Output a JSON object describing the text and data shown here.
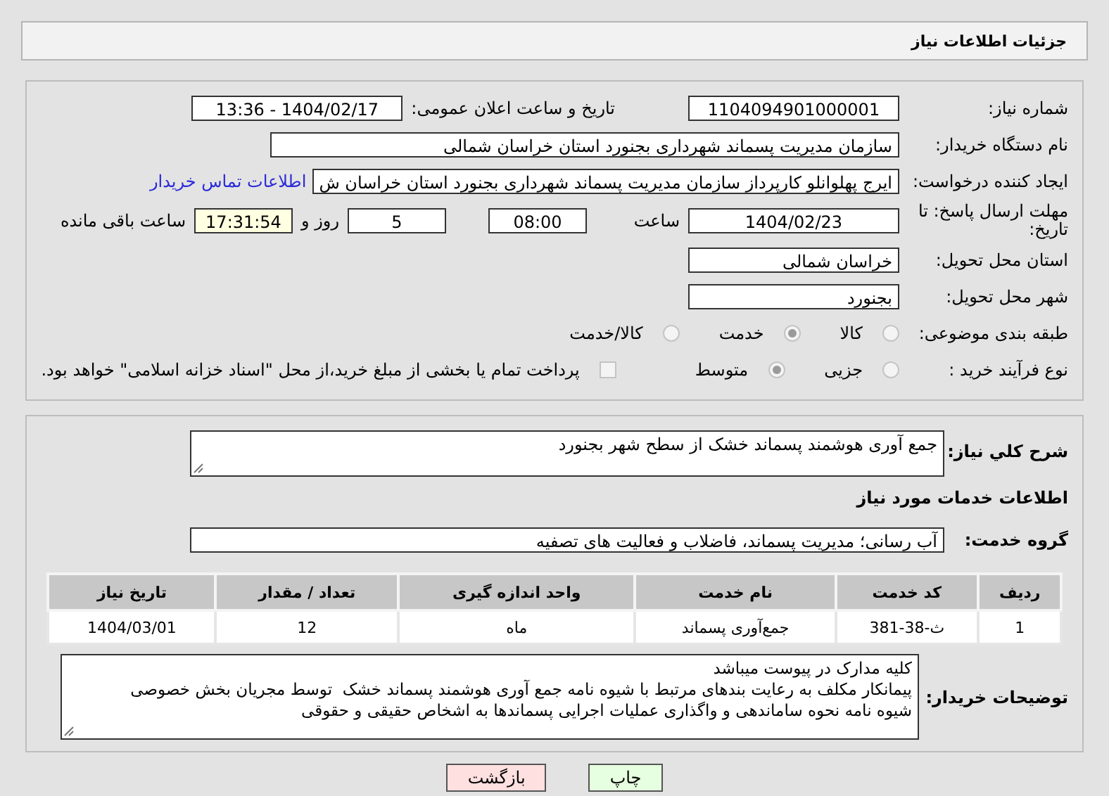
{
  "header": {
    "title": "جزئیات اطلاعات نیاز"
  },
  "need_number": {
    "label": "شماره نیاز:",
    "value": "1104094901000001"
  },
  "announce": {
    "label": "تاریخ و ساعت اعلان عمومی:",
    "value": "1404/02/17 - 13:36"
  },
  "buyer_org": {
    "label": "نام دستگاه خریدار:",
    "value": "سازمان مدیریت پسماند شهرداری بجنورد استان خراسان شمالی"
  },
  "requester": {
    "label": "ایجاد کننده درخواست:",
    "value": "ایرج پهلوانلو کارپرداز سازمان مدیریت پسماند شهرداری بجنورد استان خراسان ش",
    "link": "اطلاعات تماس خریدار"
  },
  "deadline": {
    "label": "مهلت ارسال پاسخ: تا تاریخ:",
    "date": "1404/02/23",
    "time_label": "ساعت",
    "time": "08:00",
    "days": "5",
    "days_label": "روز و",
    "remaining": "17:31:54",
    "remaining_label": "ساعت باقی مانده"
  },
  "province": {
    "label": "استان محل تحویل:",
    "value": "خراسان شمالی"
  },
  "city": {
    "label": "شهر محل تحویل:",
    "value": "بجنورد"
  },
  "category": {
    "label": "طبقه بندی موضوعی:",
    "options": [
      {
        "label": "کالا",
        "selected": false
      },
      {
        "label": "خدمت",
        "selected": true
      },
      {
        "label": "کالا/خدمت",
        "selected": false
      }
    ]
  },
  "process": {
    "label": "نوع فرآیند خرید :",
    "options": [
      {
        "label": "جزیی",
        "selected": false
      },
      {
        "label": "متوسط",
        "selected": true
      }
    ],
    "payment": {
      "label": "پرداخت تمام یا بخشی از مبلغ خرید،از محل \"اسناد خزانه اسلامی\" خواهد بود.",
      "checked": false
    }
  },
  "summary": {
    "label": "شرح کلي نياز:",
    "value": "جمع آوری هوشمند پسماند خشک از سطح شهر بجنورد"
  },
  "services_title": "اطلاعات خدمات مورد نیاز",
  "service_group": {
    "label": "گروه خدمت:",
    "value": "آب رسانی؛ مدیریت پسماند، فاضلاب و فعالیت های تصفیه"
  },
  "table": {
    "columns": [
      "ردیف",
      "کد خدمت",
      "نام خدمت",
      "واحد اندازه گیری",
      "تعداد / مقدار",
      "تاریخ نیاز"
    ],
    "rows": [
      [
        "1",
        "ث-38-381",
        "جمع‌آوری پسماند",
        "ماه",
        "12",
        "1404/03/01"
      ]
    ]
  },
  "buyer_notes": {
    "label": "توضیحات خریدار:",
    "value": "کلیه مدارک در پیوست میباشد\nپیمانکار مکلف به رعایت بندهای مرتبط با شیوه نامه جمع آوری هوشمند پسماند خشک  توسط مجریان بخش خصوصی\nشیوه نامه نحوه ساماندهی و واگذاری عملیات اجرایی پسماندها به اشخاص حقیقی و حقوقی"
  },
  "buttons": [
    {
      "label": "چاپ",
      "kind": "print"
    },
    {
      "label": "بازگشت",
      "kind": "back"
    }
  ]
}
